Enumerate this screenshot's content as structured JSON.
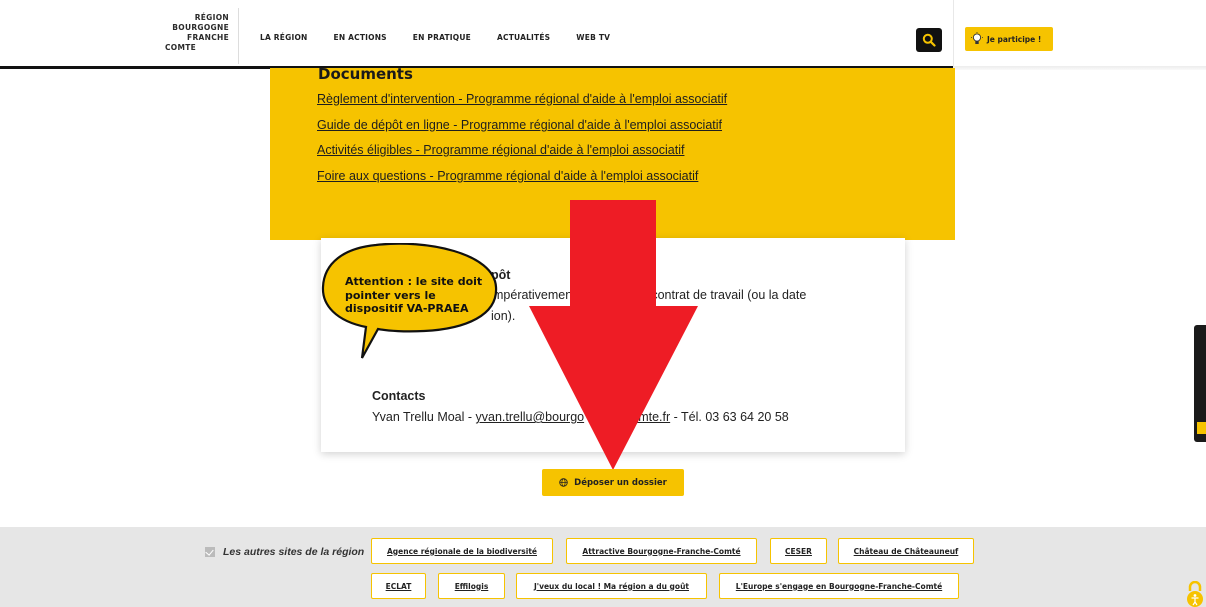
{
  "header": {
    "logo_lines": [
      "RÉGION",
      "BOURGOGNE",
      "FRANCHE",
      "COMTE"
    ],
    "nav": [
      "LA RÉGION",
      "EN ACTIONS",
      "EN PRATIQUE",
      "ACTUALITÉS",
      "WEB TV"
    ],
    "search_icon": "search-icon",
    "participate_label": "Je participe !",
    "participate_icon": "lightbulb-icon"
  },
  "documents": {
    "title": "Documents",
    "links": [
      "Règlement d'intervention - Programme régional d'aide à l'emploi associatif",
      "Guide de dépôt en ligne - Programme régional d'aide à l'emploi associatif",
      "Activités éligibles - Programme régional d'aide à l'emploi associatif",
      "Foire aux questions - Programme régional d'aide à l'emploi associatif"
    ]
  },
  "card": {
    "heading_fragment": "épôt",
    "line1_a": "mpérativemen",
    "line1_b": "t du contrat de travail (ou la date",
    "line2": "ion).",
    "contacts_title": "Contacts",
    "contact_name": "Yvan Trellu Moal - ",
    "contact_email_visible": "yvan.trellu@bourgo",
    "contact_email_tail": "comte.fr",
    "contact_phone": " - Tél. 03 63 64 20 58"
  },
  "callout": {
    "text": "Attention : le site doit pointer vers le dispositif VA-PRAEA",
    "fill": "#f6c300"
  },
  "arrow": {
    "color": "#ee1c25"
  },
  "deposit": {
    "label": "Déposer un dossier",
    "icon": "globe-icon"
  },
  "footer": {
    "label": "Les autres sites de la région",
    "sites_row1": [
      "Agence régionale de la biodiversité",
      "Attractive Bourgogne-Franche-Comté",
      "CESER",
      "Château de Châteauneuf"
    ],
    "sites_row2": [
      "ECLAT",
      "Effilogis",
      "J'veux du local ! Ma région a du goût",
      "L'Europe s'engage en Bourgogne-Franche-Comté"
    ]
  },
  "colors": {
    "accent": "#f6c300",
    "dark": "#111111",
    "footer_bg": "#e6e6e6"
  }
}
